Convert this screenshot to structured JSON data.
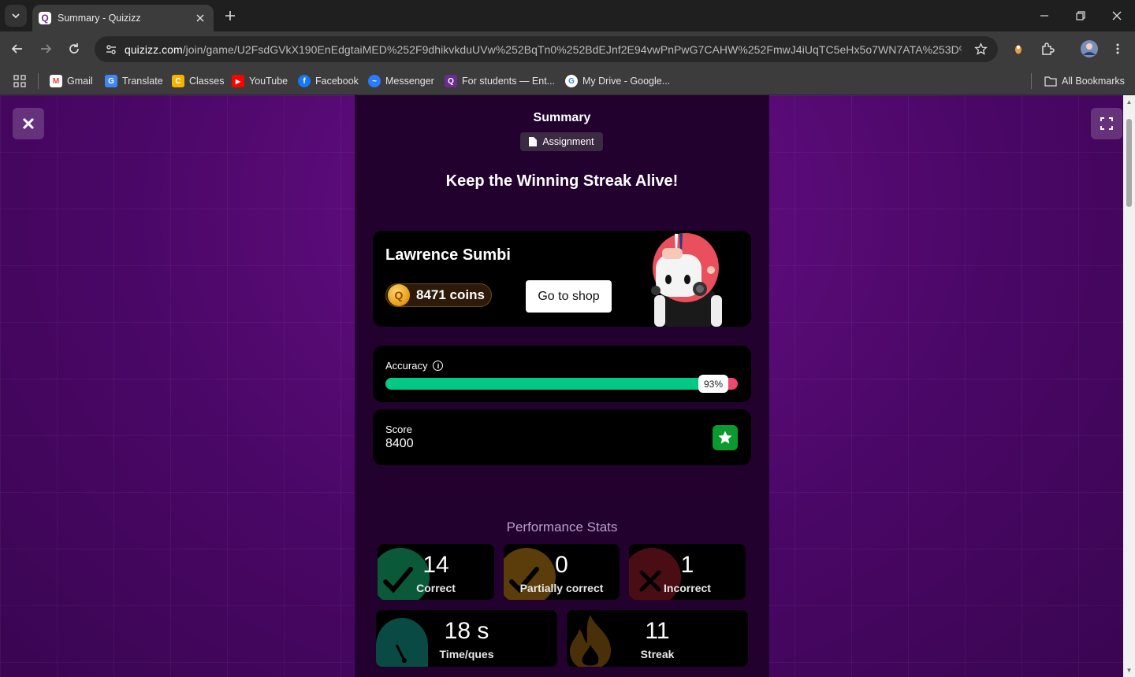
{
  "browser": {
    "tab_title": "Summary - Quizizz",
    "tab_favicon": "Q",
    "url_host": "quizizz.com",
    "url_path": "/join/game/U2FsdGVkX190EnEdgtaiMED%252F9dhikvkduUVw%252BqTn0%252BdEJnf2E94vwPnPwG7CAHW%252FmwJ4iUqTC5eHx5o7WN7ATA%253D%253D...",
    "bookmarks": [
      {
        "label": "Gmail",
        "color": "#ea4335",
        "icon": "M"
      },
      {
        "label": "Translate",
        "color": "#4285f4",
        "icon": "G"
      },
      {
        "label": "Classes",
        "color": "#f4b400",
        "icon": "C"
      },
      {
        "label": "YouTube",
        "color": "#ff0000",
        "icon": "▶"
      },
      {
        "label": "Facebook",
        "color": "#1877f2",
        "icon": "f"
      },
      {
        "label": "Messenger",
        "color": "#2b7bff",
        "icon": "~"
      },
      {
        "label": "For students — Ent...",
        "color": "#6a2c91",
        "icon": "Q"
      },
      {
        "label": "My Drive - Google...",
        "color": "#ffffff",
        "icon": "G"
      }
    ],
    "all_bookmarks": "All Bookmarks"
  },
  "summary": {
    "title": "Summary",
    "badge": "Assignment",
    "headline": "Keep the Winning Streak Alive!",
    "player_name": "Lawrence Sumbi",
    "coins": "8471 coins",
    "shop_button": "Go to shop",
    "accuracy_label": "Accuracy",
    "accuracy_percent": 93,
    "accuracy_text": "93%",
    "score_label": "Score",
    "score_value": "8400",
    "performance_title": "Performance Stats",
    "stats": {
      "correct": {
        "value": "14",
        "label": "Correct"
      },
      "partial": {
        "value": "0",
        "label": "Partially correct"
      },
      "incorrect": {
        "value": "1",
        "label": "Incorrect"
      },
      "time": {
        "value": "18 s",
        "label": "Time/ques"
      },
      "streak": {
        "value": "11",
        "label": "Streak"
      }
    }
  },
  "colors": {
    "accent_green": "#00c985",
    "accent_red": "#ef476f",
    "background_purple": "#4a0766"
  }
}
